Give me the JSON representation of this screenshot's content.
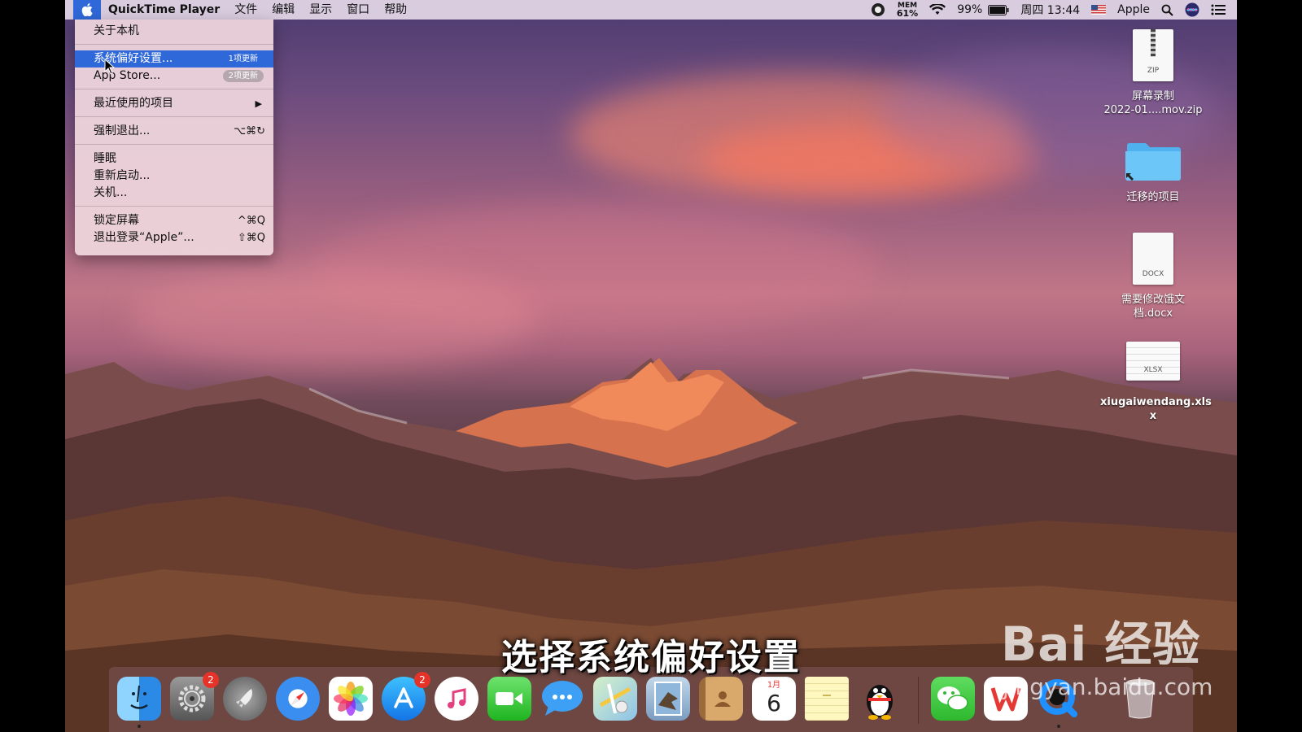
{
  "menubar": {
    "app_name": "QuickTime Player",
    "menus": [
      "文件",
      "编辑",
      "显示",
      "窗口",
      "帮助"
    ],
    "mem_label": "MEM",
    "mem_value": "61%",
    "battery": "99%",
    "clock": "周四 13:44",
    "user": "Apple"
  },
  "apple_menu": {
    "about": "关于本机",
    "prefs": "系统偏好设置...",
    "prefs_badge": "1项更新",
    "appstore": "App Store...",
    "appstore_badge": "2项更新",
    "recent": "最近使用的项目",
    "recent_arrow": "▶",
    "force_quit": "强制退出...",
    "force_quit_sc": "⌥⌘↻",
    "sleep": "睡眠",
    "restart": "重新启动...",
    "shutdown": "关机...",
    "lock": "锁定屏幕",
    "lock_sc": "^⌘Q",
    "logout": "退出登录“Apple”...",
    "logout_sc": "⇧⌘Q"
  },
  "desktop": {
    "zip": {
      "line1": "屏幕录制",
      "line2": "2022-01....mov.zip",
      "ext": "ZIP"
    },
    "folder": {
      "label": "迁移的项目"
    },
    "docx": {
      "line1": "需要修改饿文",
      "line2": "档.docx",
      "ext": "DOCX"
    },
    "xlsx": {
      "line1": "xiugaiwendang.xls",
      "line2": "x",
      "ext": "XLSX"
    }
  },
  "dock": {
    "prefs_badge": "2",
    "appstore_badge": "2",
    "calendar_month": "1月",
    "calendar_day": "6"
  },
  "caption": "选择系统偏好设置",
  "watermark": {
    "logo": "Bai 经验",
    "url": "jingyan.baidu.com"
  }
}
